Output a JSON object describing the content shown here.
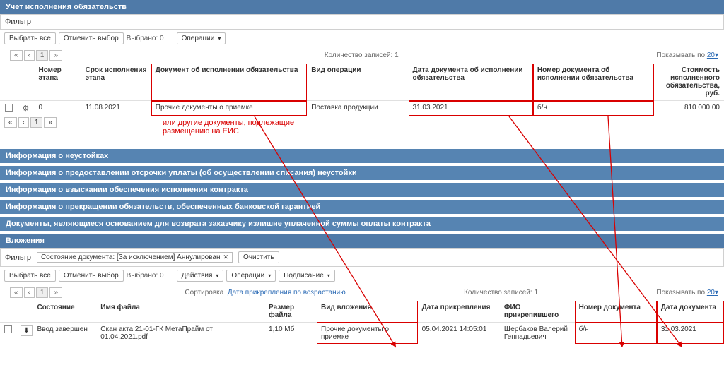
{
  "colors": {
    "accent_red": "#d90000",
    "header_blue": "#4f7aa8"
  },
  "panel1": {
    "title": "Учет исполнения обязательств",
    "filter_label": "Фильтр",
    "select_all": "Выбрать все",
    "clear_sel": "Отменить выбор",
    "selected_prefix": "Выбрано:",
    "selected_count": "0",
    "ops": "Операции",
    "records_prefix": "Количество записей:",
    "records_count": "1",
    "show_by": "Показывать по",
    "show_val": "20",
    "headers": {
      "stage": "Номер этапа",
      "due": "Срок исполнения этапа",
      "doc": "Документ об исполнении обязательства",
      "op": "Вид операции",
      "ddate": "Дата документа об исполнении обязательства",
      "dnum": "Номер документа об исполнении обязательства",
      "cost": "Стоимость исполненного обязательства, руб."
    },
    "row": {
      "stage": "0",
      "due": "11.08.2021",
      "doc": "Прочие документы о приемке",
      "op": "Поставка продукции",
      "ddate": "31.03.2021",
      "dnum": "б/н",
      "cost": "810 000,00"
    },
    "annotation": "или другие документы, подлежащие размещению на ЕИС"
  },
  "sections": [
    "Информация о неустойках",
    "Информация о предоставлении отсрочки уплаты (об осуществлении списания) неустойки",
    "Информация о взыскании обеспечения исполнения контракта",
    "Информация о прекращении обязательств, обеспеченных банковской гарантией",
    "Документы, являющиеся основанием для возврата заказчику излишне уплаченной суммы оплаты контракта"
  ],
  "panel2": {
    "title": "Вложения",
    "filter_label": "Фильтр",
    "state_filter_label": "Состояние документа: [За исключением] Аннулирован",
    "clear": "Очистить",
    "select_all": "Выбрать все",
    "clear_sel": "Отменить выбор",
    "selected_prefix": "Выбрано:",
    "selected_count": "0",
    "actions": "Действия",
    "ops": "Операции",
    "signing": "Подписание",
    "sort_label": "Сортировка",
    "sort_value": "Дата прикрепления по возрастанию",
    "records_prefix": "Количество записей:",
    "records_count": "1",
    "show_by": "Показывать по",
    "show_val": "20",
    "headers": {
      "state": "Состояние",
      "file": "Имя файла",
      "size": "Размер файла",
      "kind": "Вид вложения",
      "attached": "Дата прикрепления",
      "who": "ФИО прикрепившего",
      "num": "Номер документа",
      "date": "Дата документа"
    },
    "row": {
      "state": "Ввод завершен",
      "file": "Скан акта 21-01-ГК МетаПрайм от 01.04.2021.pdf",
      "size": "1,10 Мб",
      "kind": "Прочие документы о приемке",
      "attached": "05.04.2021 14:05:01",
      "who": "Щербаков Валерий Геннадьевич",
      "num": "б/н",
      "date": "31.03.2021"
    }
  },
  "pager": {
    "prev": "«",
    "p1": "1",
    "next": "»",
    "ell": "‹"
  }
}
